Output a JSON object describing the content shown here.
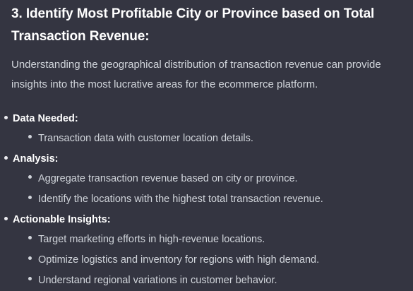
{
  "section": {
    "title": "3. Identify Most Profitable City or Province based on Total Transaction Revenue:",
    "intro": "Understanding the geographical distribution of transaction revenue can provide insights into the most lucrative areas for the ecommerce platform."
  },
  "groups": [
    {
      "heading": "Data Needed:",
      "items": [
        "Transaction data with customer location details."
      ]
    },
    {
      "heading": "Analysis:",
      "items": [
        "Aggregate transaction revenue based on city or province.",
        "Identify the locations with the highest total transaction revenue."
      ]
    },
    {
      "heading": "Actionable Insights:",
      "items": [
        "Target marketing efforts in high-revenue locations.",
        "Optimize logistics and inventory for regions with high demand.",
        "Understand regional variations in customer behavior."
      ]
    }
  ]
}
